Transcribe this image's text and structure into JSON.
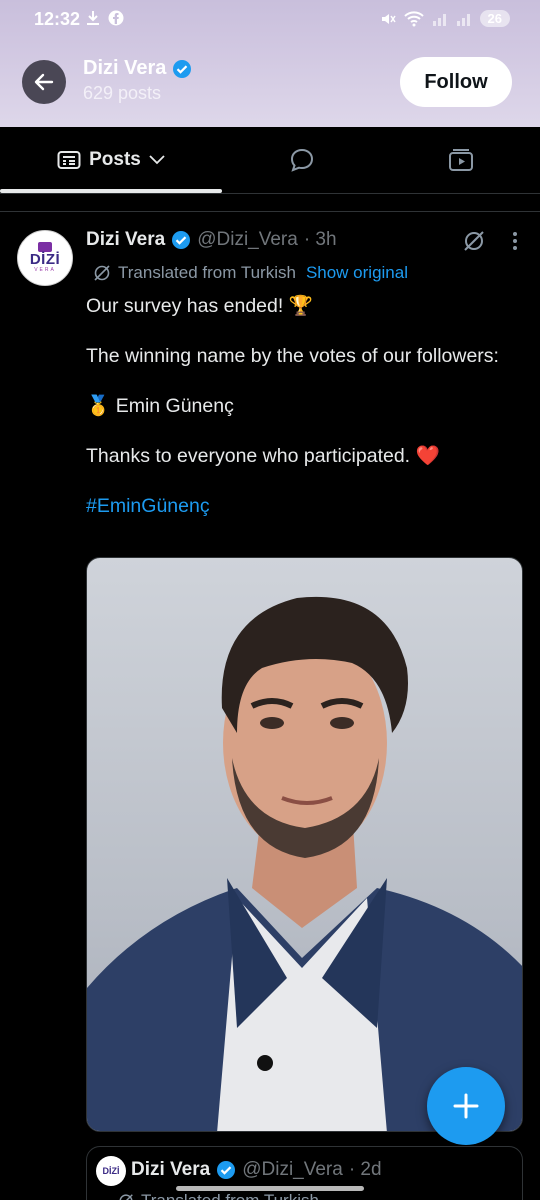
{
  "status_bar": {
    "time": "12:32",
    "battery": "26"
  },
  "header": {
    "profile_name": "Dizi Vera",
    "posts_count": "629 posts",
    "follow_label": "Follow"
  },
  "tabs": {
    "posts_label": "Posts"
  },
  "post": {
    "avatar_text": "DİZİ",
    "avatar_sub": "VERA",
    "author": "Dizi Vera",
    "handle": "@Dizi_Vera",
    "time": "· 3h",
    "translated_label": "Translated from Turkish",
    "show_original": "Show original",
    "line1": "Our survey has ended! 🏆",
    "line2": "The winning name by the votes of our followers:",
    "line3": "🥇 Emin Günenç",
    "line4": "Thanks to everyone who participated. ❤️",
    "hashtag": "#EminGünenç"
  },
  "quote": {
    "avatar_text": "DİZİ",
    "author": "Dizi Vera",
    "handle": "@Dizi_Vera",
    "time": "· 2d",
    "translated_label": "Translated from Turkish"
  },
  "colors": {
    "accent": "#1d9bf0",
    "background": "#000000",
    "verified": "#1d9bf0"
  }
}
